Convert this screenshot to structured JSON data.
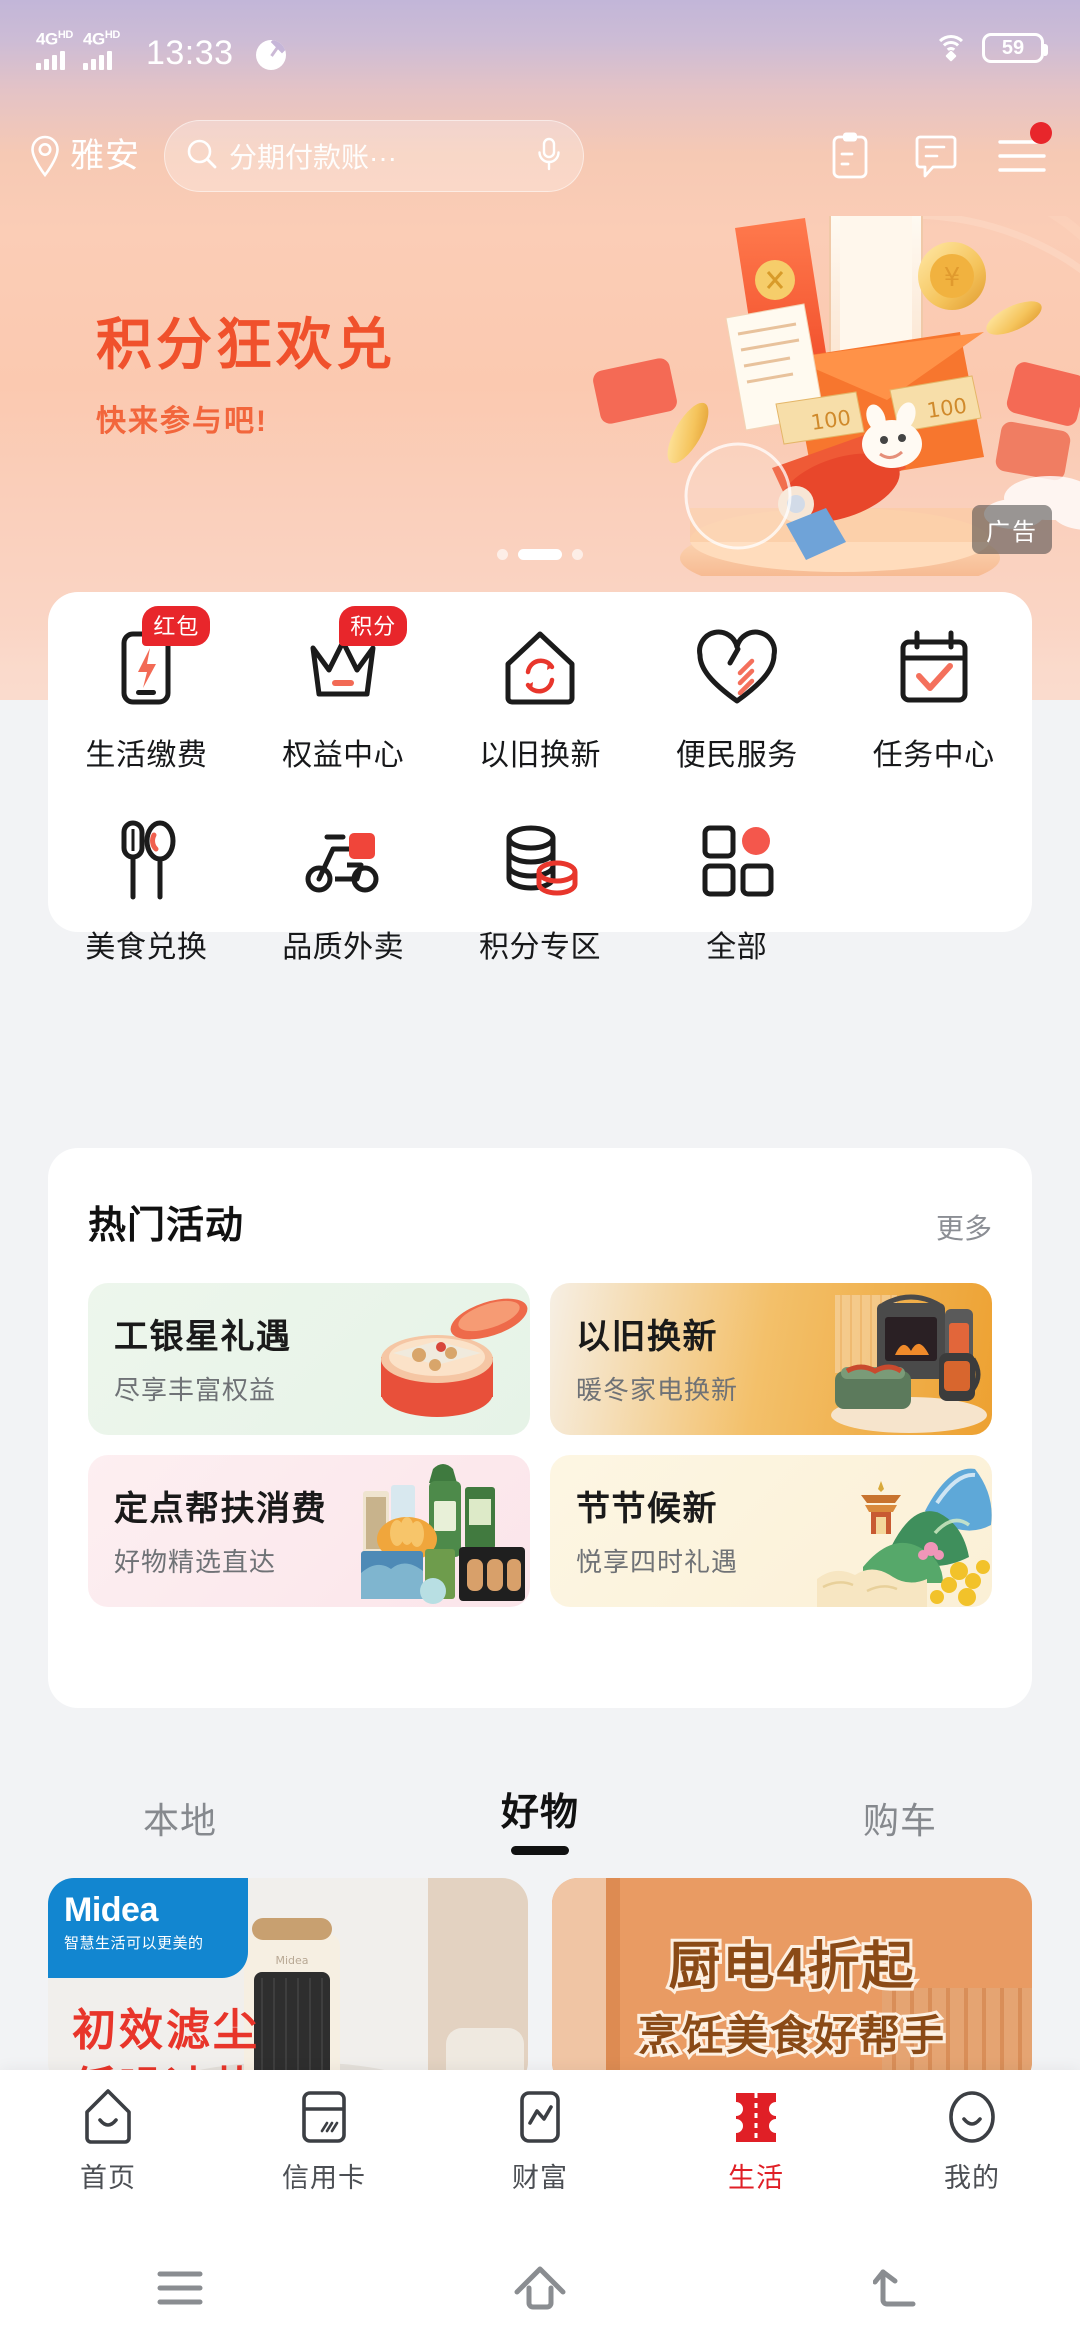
{
  "status_bar": {
    "carrier1": "4G",
    "carrier1_sup": "HD",
    "carrier2": "4G",
    "carrier2_sup": "HD",
    "time": "13:33",
    "battery_percent": "59",
    "wifi_icon": "wifi-icon",
    "alarm_icon": "clock-icon"
  },
  "header": {
    "location_icon": "location-pin-icon",
    "location": "雅安",
    "search": {
      "icon": "search-icon",
      "value": "分期付款账···",
      "placeholder": "搜索",
      "mic_icon": "microphone-icon"
    },
    "icons": [
      {
        "name": "clipboard-icon",
        "label": "清单"
      },
      {
        "name": "chat-icon",
        "label": "消息"
      },
      {
        "name": "menu-icon",
        "label": "菜单",
        "badge": true
      }
    ]
  },
  "banner": {
    "title": "积分狂欢兑",
    "subtitle": "快来参与吧!",
    "ad_label": "广告",
    "dots_total": 3,
    "dots_active": 1,
    "title_color": "#f0512c",
    "subtitle_color": "#f2663c"
  },
  "quick_grid": {
    "row1": [
      {
        "label": "生活缴费",
        "icon": "phone-bolt-icon",
        "badge": "红包"
      },
      {
        "label": "权益中心",
        "icon": "crown-icon",
        "badge": "积分"
      },
      {
        "label": "以旧换新",
        "icon": "house-recycle-icon",
        "badge": null
      },
      {
        "label": "便民服务",
        "icon": "heart-icon",
        "badge": null
      },
      {
        "label": "任务中心",
        "icon": "calendar-check-icon",
        "badge": null
      }
    ],
    "row2": [
      {
        "label": "美食兑换",
        "icon": "utensils-icon",
        "badge": null
      },
      {
        "label": "品质外卖",
        "icon": "scooter-icon",
        "badge": null
      },
      {
        "label": "积分专区",
        "icon": "coins-icon",
        "badge": null
      },
      {
        "label": "全部",
        "icon": "grid-icon",
        "badge": null
      }
    ]
  },
  "hot_activities": {
    "title": "热门活动",
    "more": "更多",
    "items": [
      {
        "title": "工银星礼遇",
        "subtitle": "尽享丰富权益",
        "bg": "#eaf5ea",
        "thumb": "gift-box-thumb"
      },
      {
        "title": "以旧换新",
        "subtitle": "暖冬家电换新",
        "bg": "#f0b24a",
        "thumb": "appliances-thumb"
      },
      {
        "title": "定点帮扶消费",
        "subtitle": "好物精选直达",
        "bg": "#fbe8ec",
        "thumb": "grocery-thumb"
      },
      {
        "title": "节节候新",
        "subtitle": "悦享四时礼遇",
        "bg": "#fcf3dc",
        "thumb": "landscape-thumb"
      }
    ]
  },
  "tabs": [
    {
      "label": "本地",
      "active": false
    },
    {
      "label": "好物",
      "active": true
    },
    {
      "label": "购车",
      "active": false
    }
  ],
  "products": [
    {
      "brand": "Midea",
      "brand_tagline": "智慧生活可以更美的",
      "line1": "初效滤尘",
      "line2": "低噪速热",
      "brand_bg": "#1286d0",
      "text_color": "#e8352a"
    },
    {
      "line1": "厨电4折起",
      "line2": "烹饪美食好帮手",
      "text_color": "#8a4a16"
    }
  ],
  "bottom_nav": [
    {
      "label": "首页",
      "icon": "home-icon",
      "active": false
    },
    {
      "label": "信用卡",
      "icon": "credit-card-icon",
      "active": false
    },
    {
      "label": "财富",
      "icon": "chart-icon",
      "active": false
    },
    {
      "label": "生活",
      "icon": "ticket-icon",
      "active": true
    },
    {
      "label": "我的",
      "icon": "profile-icon",
      "active": false
    }
  ],
  "system_nav": [
    {
      "name": "recents-button",
      "icon": "hamburger-icon"
    },
    {
      "name": "home-button",
      "icon": "home-arrow-icon"
    },
    {
      "name": "back-button",
      "icon": "back-arrow-icon"
    }
  ],
  "theme": {
    "accent_red": "#e01f26",
    "badge_red": "#e8262b",
    "page_bg": "#f2f3f5"
  }
}
